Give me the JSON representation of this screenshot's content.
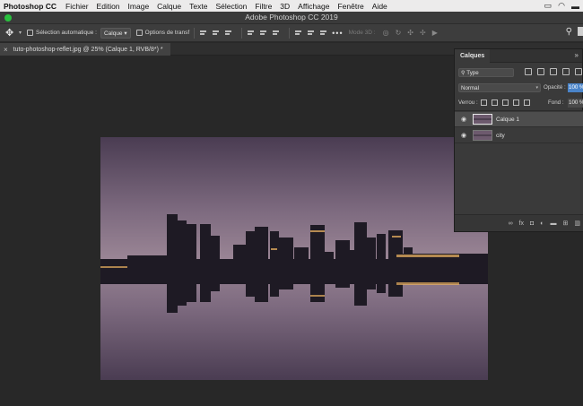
{
  "menubar": {
    "app_name": "Photoshop CC",
    "items": [
      "Fichier",
      "Edition",
      "Image",
      "Calque",
      "Texte",
      "Sélection",
      "Filtre",
      "3D",
      "Affichage",
      "Fenêtre",
      "Aide"
    ]
  },
  "window": {
    "title": "Adobe Photoshop CC 2019"
  },
  "options_bar": {
    "auto_select_label": "Sélection automatique :",
    "auto_select_value": "Calque",
    "transform_label": "Options de transf",
    "mode_3d_label": "Mode 3D :"
  },
  "document_tab": {
    "close_glyph": "×",
    "title": "tuto-photoshop-reflet.jpg @ 25% (Calque 1, RVB/8*) *"
  },
  "layers_panel": {
    "tab_label": "Calques",
    "filter_value": "Type",
    "blend_mode": "Normal",
    "opacity_label": "Opacité :",
    "opacity_value": "100 %",
    "lock_label": "Verrou :",
    "fill_label": "Fond :",
    "fill_value": "100 %",
    "layers": [
      {
        "name": "Calque 1",
        "selected": true
      },
      {
        "name": "city",
        "selected": false
      }
    ],
    "footer_icons": [
      "link-icon",
      "fx-icon",
      "mask-icon",
      "adjustment-icon",
      "folder-icon",
      "new-layer-icon",
      "trash-icon"
    ]
  },
  "colors": {
    "sky_top": "#4e3f55",
    "sky_mid": "#8a7488",
    "skyline": "#1f1a24",
    "accent_selection": "#4a84c9"
  }
}
